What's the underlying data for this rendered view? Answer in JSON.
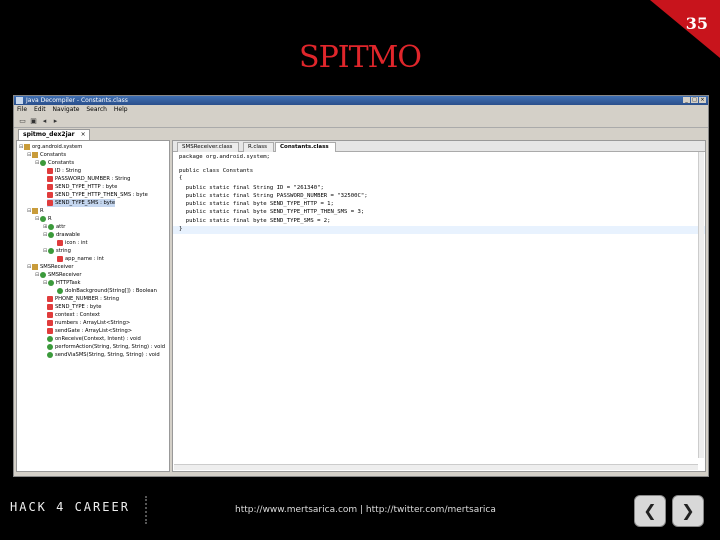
{
  "slide": {
    "number": "35",
    "title": "SPITMO"
  },
  "window": {
    "title": "Java Decompiler - Constants.class",
    "menu": [
      "File",
      "Edit",
      "Navigate",
      "Search",
      "Help"
    ],
    "file_tab": "spitmo_dex2jar"
  },
  "tree": {
    "nodes": [
      "org.android.system",
      "Constants",
      "Constants",
      "ID : String",
      "PASSWORD_NUMBER : String",
      "SEND_TYPE_HTTP : byte",
      "SEND_TYPE_HTTP_THEN_SMS : byte",
      "SEND_TYPE_SMS : byte",
      "R",
      "R",
      "attr",
      "drawable",
      "icon : int",
      "string",
      "app_name : int",
      "SMSReceiver",
      "SMSReceiver",
      "HTTPTask",
      "doInBackground(String[]) : Boolean",
      "PHONE_NUMBER : String",
      "SEND_TYPE : byte",
      "context : Context",
      "numbers : ArrayList<String>",
      "sendGate : ArrayList<String>",
      "onReceive(Context, Intent) : void",
      "performAction(String, String, String) : void",
      "sendViaSMS(String, String, String) : void"
    ]
  },
  "editor": {
    "tabs": [
      "SMSReceiver.class",
      "R.class",
      "Constants.class"
    ],
    "code": [
      "package org.android.system;",
      "",
      "public class Constants",
      "{",
      "  public static final String ID = \"261340\";",
      "  public static final String PASSWORD_NUMBER = \"32500C\";",
      "  public static final byte SEND_TYPE_HTTP = 1;",
      "  public static final byte SEND_TYPE_HTTP_THEN_SMS = 3;",
      "  public static final byte SEND_TYPE_SMS = 2;",
      "}"
    ]
  },
  "footer": {
    "brand": "HACK 4 CAREER",
    "links": "http://www.mertsarica.com | http://twitter.com/mertsarica"
  },
  "colors": {
    "accent": "#c8141c",
    "title": "#e0262b"
  }
}
